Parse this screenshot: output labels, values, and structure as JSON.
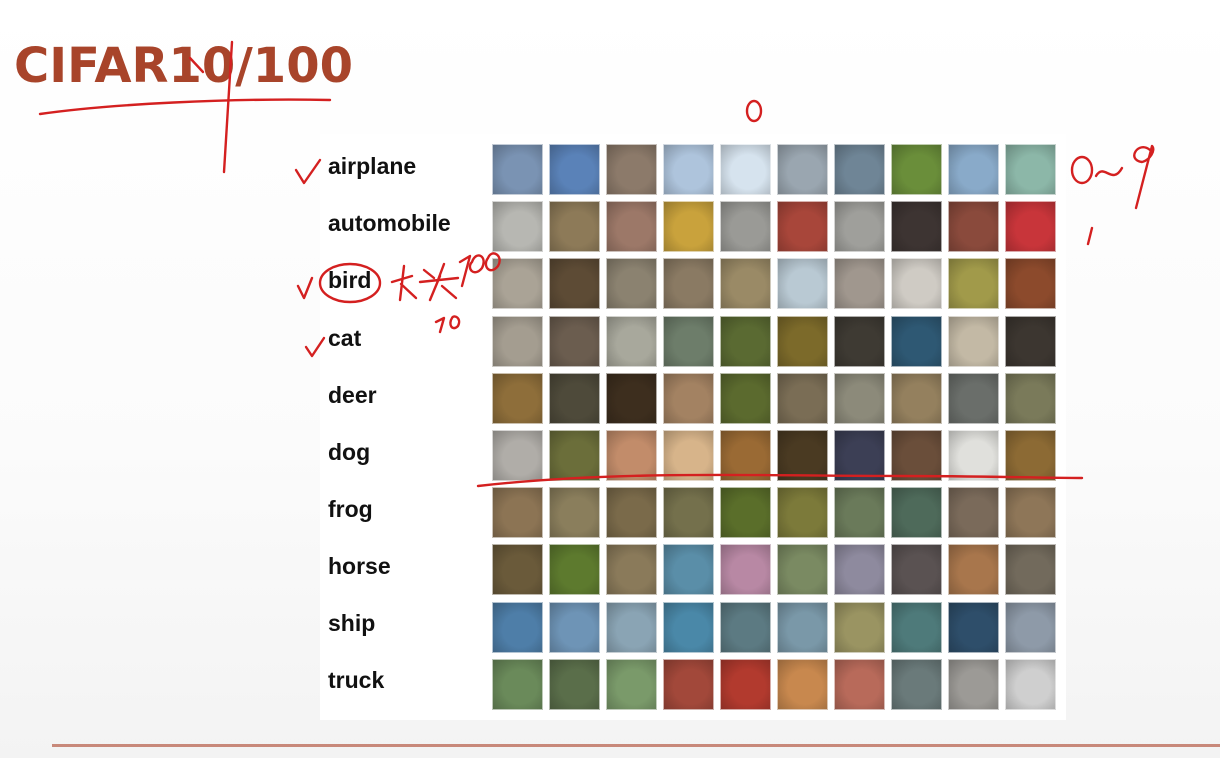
{
  "slide": {
    "title": "CIFAR10/100",
    "handwriting_color": "#d42020"
  },
  "categories": [
    {
      "label": "airplane",
      "checked": true,
      "tile_colors": [
        "#7a93b3",
        "#5a82b8",
        "#8c7a6a",
        "#aec4dc",
        "#d6e3ee",
        "#9aa6b0",
        "#6f8596",
        "#6a8e3a",
        "#89aac9",
        "#8cb7a8"
      ]
    },
    {
      "label": "automobile",
      "checked": false,
      "tile_colors": [
        "#b7b7b2",
        "#8d7a58",
        "#9c7868",
        "#c9a23c",
        "#9a9a96",
        "#a8463a",
        "#9f9f9b",
        "#3d3432",
        "#8a4a3c",
        "#c8353a"
      ]
    },
    {
      "label": "bird",
      "checked": true,
      "tile_colors": [
        "#aaa396",
        "#5d4b35",
        "#8b8270",
        "#8a7a63",
        "#9a8a66",
        "#b9c9d3",
        "#a0978e",
        "#cfcbc4",
        "#a19a4a",
        "#8c4a2c"
      ]
    },
    {
      "label": "cat",
      "checked": true,
      "tile_colors": [
        "#a49d90",
        "#6b5d4f",
        "#a8a89c",
        "#6d7d6a",
        "#5a6a32",
        "#7c6a2a",
        "#3e3a33",
        "#2e5873",
        "#c3b9a5",
        "#3c3630"
      ]
    },
    {
      "label": "deer",
      "checked": false,
      "tile_colors": [
        "#8e6e3a",
        "#4e4a3a",
        "#3d2e1e",
        "#a38262",
        "#5b6a2e",
        "#7a6d55",
        "#8c8a7a",
        "#94805e",
        "#6a6e6a",
        "#7a7a5a"
      ]
    },
    {
      "label": "dog",
      "checked": false,
      "tile_colors": [
        "#b0ada8",
        "#6b6e3a",
        "#c28c6a",
        "#d7b48a",
        "#9a6a34",
        "#4a3a22",
        "#3c3f55",
        "#6a4e3a",
        "#e0e0dc",
        "#8c6a34"
      ]
    },
    {
      "label": "frog",
      "checked": false,
      "tile_colors": [
        "#8c7454",
        "#8a7e5c",
        "#7a6a4a",
        "#74704c",
        "#5a6e2a",
        "#7c7a3a",
        "#6a7a5a",
        "#4e6a5a",
        "#7a6a5a",
        "#8e7658"
      ]
    },
    {
      "label": "horse",
      "checked": false,
      "tile_colors": [
        "#6a5a3a",
        "#5d7a2e",
        "#8a7a5a",
        "#5a8ea8",
        "#b888a4",
        "#7a8a62",
        "#8e8a9e",
        "#5a5252",
        "#a8764c",
        "#726a5c"
      ]
    },
    {
      "label": "ship",
      "checked": false,
      "tile_colors": [
        "#4e7ea8",
        "#6e94b6",
        "#8aa4b4",
        "#4a88a8",
        "#5c7a82",
        "#7a98a8",
        "#9a9462",
        "#4e7a7a",
        "#2e4e6a",
        "#8e9aa8"
      ]
    },
    {
      "label": "truck",
      "checked": false,
      "tile_colors": [
        "#6a8a5a",
        "#5a6e4a",
        "#7a9a6a",
        "#a2483a",
        "#b23a2e",
        "#c8884e",
        "#b86a5a",
        "#6a7a7a",
        "#9c9a96",
        "#cfcfcf"
      ]
    }
  ],
  "handwriting": {
    "zero_mark": "0",
    "range_mark": "0~9",
    "one_mark": "1",
    "bird_note": "大类100",
    "bird_subnote": "20",
    "deer_dot": "."
  }
}
